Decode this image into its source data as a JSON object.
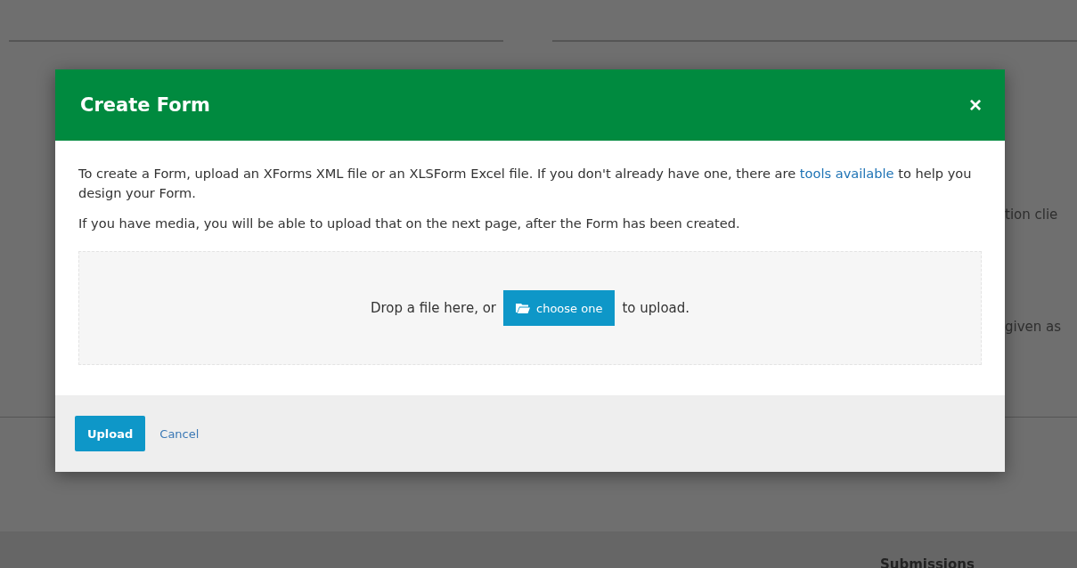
{
  "background": {
    "texts": [
      "tion clie",
      "given as"
    ],
    "footer_heading": "Submissions"
  },
  "dialog": {
    "title": "Create Form",
    "close_label": "×",
    "intro": {
      "before": "To create a Form, upload an XForms XML file or an XLSForm Excel file. If you don't already have one, there are ",
      "link": "tools available",
      "after": " to help you design your Form."
    },
    "media_note": "If you have media, you will be able to upload that on the next page, after the Form has been created.",
    "dropzone": {
      "before": "Drop a file here, or",
      "button": "choose one",
      "after": "to upload."
    },
    "buttons": [
      {
        "label": "Upload",
        "kind": "primary"
      },
      {
        "label": "Cancel",
        "kind": "link"
      }
    ]
  }
}
